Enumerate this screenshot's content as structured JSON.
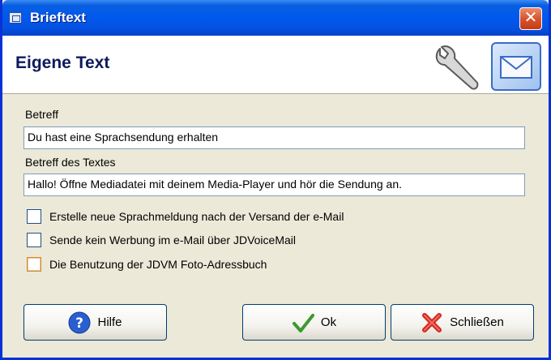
{
  "window": {
    "title": "Brieftext",
    "close_glyph": "✕"
  },
  "header": {
    "title": "Eigene Text",
    "icons": [
      "wrench-icon",
      "mail-icon"
    ]
  },
  "form": {
    "subject_label": "Betreff",
    "subject_value": "Du hast eine Sprachsendung erhalten",
    "body_label": "Betreff des Textes",
    "body_value": "Hallo! Öffne Mediadatei mit deinem Media-Player und hör die Sendung an."
  },
  "options": [
    {
      "label": "Erstelle neue Sprachmeldung nach der Versand der e-Mail",
      "checked": false
    },
    {
      "label": "Sende kein Werbung im e-Mail über JDVoiceMail",
      "checked": false
    },
    {
      "label": "Die Benutzung der JDVM Foto-Adressbuch",
      "checked": false
    }
  ],
  "buttons": {
    "help": "Hilfe",
    "ok": "Ok",
    "close": "Schließen"
  },
  "colors": {
    "title_bar": "#0058ee",
    "header_title": "#0d1a5e",
    "dialog_bg": "#ece9d8"
  }
}
